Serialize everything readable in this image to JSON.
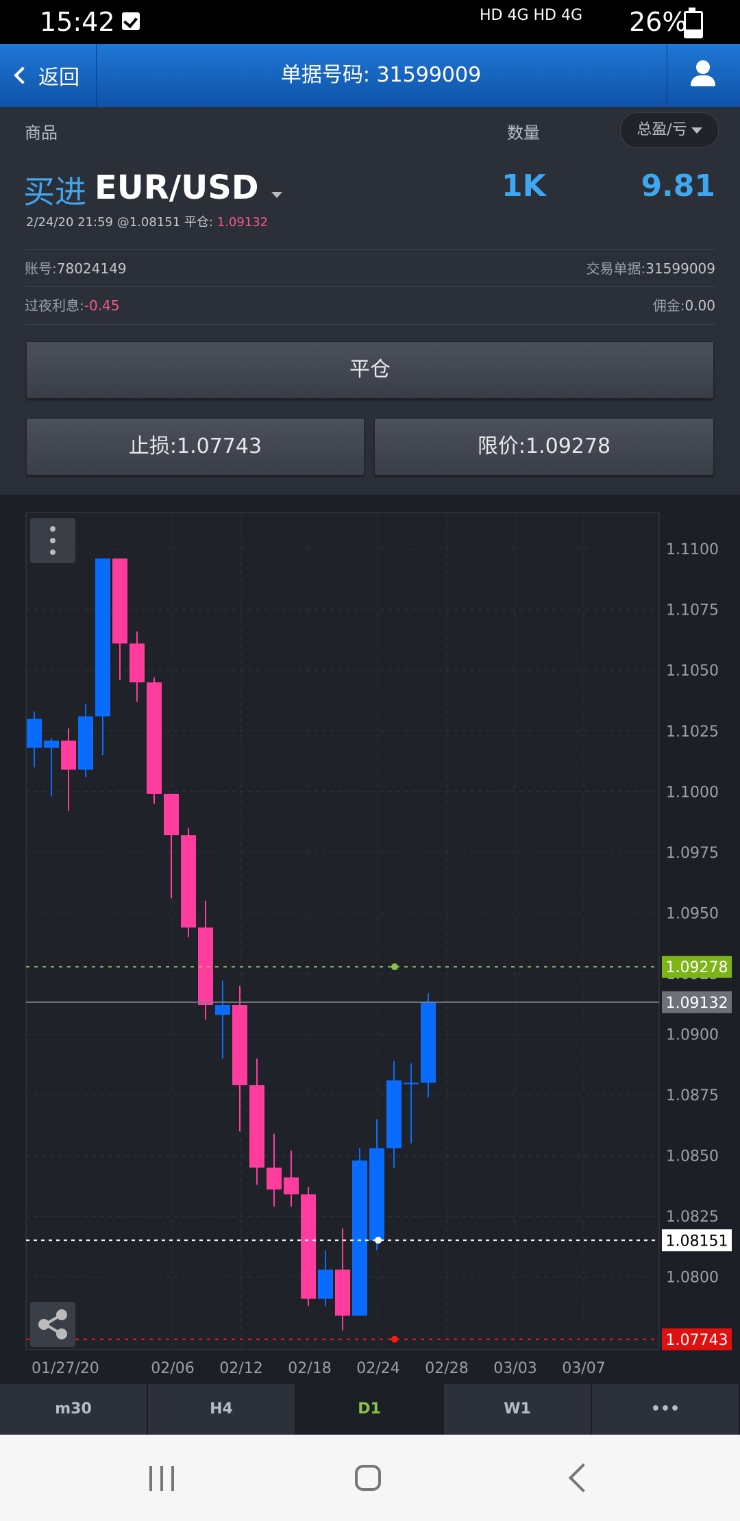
{
  "status_bar": {
    "time": "15:42",
    "network": "HD 4G HD 4G",
    "battery": "26%"
  },
  "nav": {
    "back_label": "返回",
    "title": "单据号码: 31599009"
  },
  "columns": {
    "product": "商品",
    "quantity": "数量",
    "pnl_filter": "总盈/亏"
  },
  "trade": {
    "side": "买进",
    "symbol": "EUR/USD",
    "quantity": "1K",
    "pnl": "9.81",
    "opened": "2/24/20 21:59 @1.08151",
    "close_label": "平仓:",
    "close_price": "1.09132",
    "account_label": "账号:",
    "account": "78024149",
    "ticket_label": "交易单据:",
    "ticket": "31599009",
    "swap_label": "过夜利息:",
    "swap": "-0.45",
    "commission_label": "佣金:",
    "commission": "0.00"
  },
  "buttons": {
    "close_position": "平仓",
    "stop_loss": "止损:1.07743",
    "limit": "限价:1.09278"
  },
  "colors": {
    "bullish": "#0a6cff",
    "bearish": "#ff3d9e",
    "take_profit": "#8bc34a",
    "stop_loss": "#ff1a1a",
    "accent": "#3fa6f0"
  },
  "chart_data": {
    "type": "candlestick",
    "timeframe": "D1",
    "y_ticks": [
      1.11,
      1.1075,
      1.105,
      1.1025,
      1.1,
      1.0975,
      1.095,
      1.0925,
      1.09,
      1.0875,
      1.085,
      1.0825,
      1.08
    ],
    "y_tick_labels": [
      "1.1100",
      "1.1075",
      "1.1050",
      "1.1025",
      "1.1000",
      "1.0975",
      "1.0950",
      "1.0925",
      "1.0900",
      "1.0875",
      "1.0850",
      "1.0825",
      "1.0800"
    ],
    "ylim": [
      1.077,
      1.1115
    ],
    "x_labels": [
      "01/27/20",
      "02/06",
      "02/12",
      "02/18",
      "02/24",
      "02/28",
      "03/03",
      "03/07"
    ],
    "candles": [
      {
        "o": 1.1018,
        "h": 1.1033,
        "l": 1.101,
        "c": 1.103
      },
      {
        "o": 1.1018,
        "h": 1.1022,
        "l": 1.0998,
        "c": 1.1021
      },
      {
        "o": 1.1021,
        "h": 1.1026,
        "l": 1.0992,
        "c": 1.1009
      },
      {
        "o": 1.1009,
        "h": 1.1036,
        "l": 1.1006,
        "c": 1.1031
      },
      {
        "o": 1.1031,
        "h": 1.1096,
        "l": 1.1015,
        "c": 1.1096
      },
      {
        "o": 1.1096,
        "h": 1.1096,
        "l": 1.1046,
        "c": 1.1061
      },
      {
        "o": 1.1061,
        "h": 1.1066,
        "l": 1.1037,
        "c": 1.1045
      },
      {
        "o": 1.1045,
        "h": 1.1047,
        "l": 1.0995,
        "c": 1.0999
      },
      {
        "o": 1.0999,
        "h": 1.0999,
        "l": 1.0956,
        "c": 1.0982
      },
      {
        "o": 1.0982,
        "h": 1.0985,
        "l": 1.094,
        "c": 1.0944
      },
      {
        "o": 1.0944,
        "h": 1.0955,
        "l": 1.0906,
        "c": 1.0912
      },
      {
        "o": 1.0908,
        "h": 1.0922,
        "l": 1.089,
        "c": 1.0912
      },
      {
        "o": 1.0912,
        "h": 1.092,
        "l": 1.086,
        "c": 1.0879
      },
      {
        "o": 1.0879,
        "h": 1.089,
        "l": 1.0838,
        "c": 1.0845
      },
      {
        "o": 1.0845,
        "h": 1.0859,
        "l": 1.0829,
        "c": 1.0836
      },
      {
        "o": 1.0841,
        "h": 1.0852,
        "l": 1.0829,
        "c": 1.0834
      },
      {
        "o": 1.0834,
        "h": 1.0837,
        "l": 1.0788,
        "c": 1.0791
      },
      {
        "o": 1.0791,
        "h": 1.0811,
        "l": 1.0788,
        "c": 1.0803
      },
      {
        "o": 1.0803,
        "h": 1.082,
        "l": 1.0778,
        "c": 1.0784
      },
      {
        "o": 1.0784,
        "h": 1.0853,
        "l": 1.0784,
        "c": 1.0848
      },
      {
        "o": 1.0815,
        "h": 1.0865,
        "l": 1.0811,
        "c": 1.0853
      },
      {
        "o": 1.0853,
        "h": 1.0889,
        "l": 1.0845,
        "c": 1.0881
      },
      {
        "o": 1.088,
        "h": 1.0888,
        "l": 1.0855,
        "c": 1.088
      },
      {
        "o": 1.088,
        "h": 1.0917,
        "l": 1.0874,
        "c": 1.0913
      }
    ],
    "lines": [
      {
        "label": "1.09278",
        "value": 1.09278,
        "style": "take-profit"
      },
      {
        "label": "1.09132",
        "value": 1.09132,
        "style": "current"
      },
      {
        "label": "1.08151",
        "value": 1.08151,
        "style": "entry"
      },
      {
        "label": "1.07743",
        "value": 1.07743,
        "style": "stop-loss"
      }
    ]
  },
  "timeframes": [
    "m30",
    "H4",
    "D1",
    "W1",
    "•••"
  ]
}
